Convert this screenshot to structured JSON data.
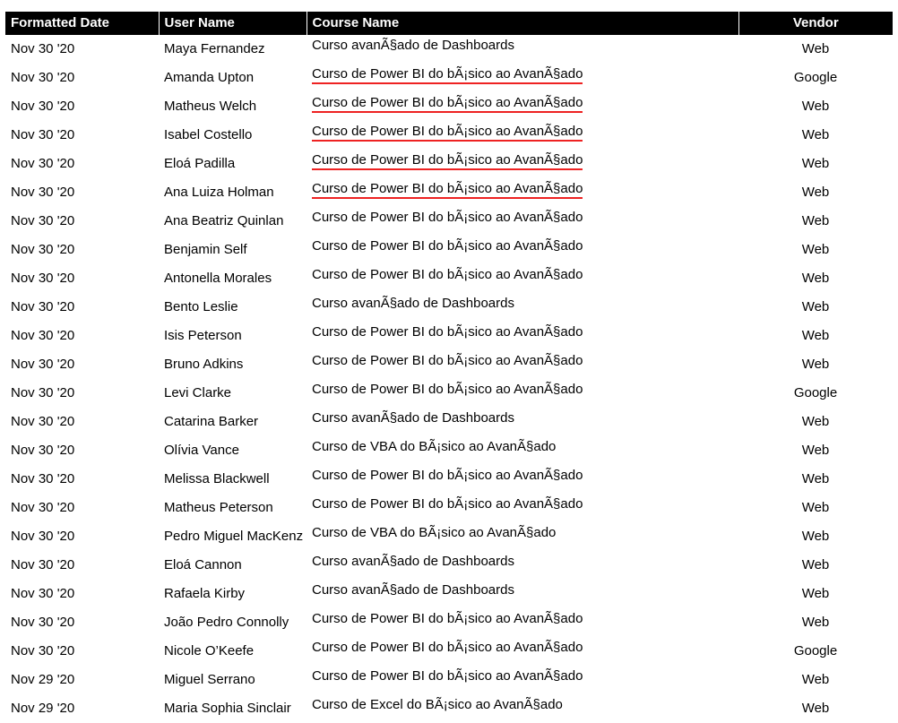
{
  "sheet": {
    "columns": [
      {
        "key": "date",
        "label": "Formatted Date",
        "align": "left"
      },
      {
        "key": "user",
        "label": "User Name",
        "align": "left"
      },
      {
        "key": "course",
        "label": "Course Name",
        "align": "left"
      },
      {
        "key": "vendor",
        "label": "Vendor",
        "align": "center"
      }
    ],
    "header_background": "#000000",
    "header_color": "#ffffff",
    "underline_color": "#ee2222",
    "rows": [
      {
        "date": "Nov 30 '20",
        "user": "Maya Fernandez",
        "course": "Curso avanÃ§ado de Dashboards",
        "vendor": "Web",
        "underlined": false
      },
      {
        "date": "Nov 30 '20",
        "user": "Amanda Upton",
        "course": "Curso de Power BI do bÃ¡sico ao AvanÃ§ado",
        "vendor": "Google",
        "underlined": true
      },
      {
        "date": "Nov 30 '20",
        "user": "Matheus Welch",
        "course": "Curso de Power BI do bÃ¡sico ao AvanÃ§ado",
        "vendor": "Web",
        "underlined": true
      },
      {
        "date": "Nov 30 '20",
        "user": "Isabel Costello",
        "course": "Curso de Power BI do bÃ¡sico ao AvanÃ§ado",
        "vendor": "Web",
        "underlined": true
      },
      {
        "date": "Nov 30 '20",
        "user": "Eloá Padilla",
        "course": "Curso de Power BI do bÃ¡sico ao AvanÃ§ado",
        "vendor": "Web",
        "underlined": true
      },
      {
        "date": "Nov 30 '20",
        "user": "Ana Luiza Holman",
        "course": "Curso de Power BI do bÃ¡sico ao AvanÃ§ado",
        "vendor": "Web",
        "underlined": true
      },
      {
        "date": "Nov 30 '20",
        "user": "Ana Beatriz Quinlan",
        "course": "Curso de Power BI do bÃ¡sico ao AvanÃ§ado",
        "vendor": "Web",
        "underlined": false
      },
      {
        "date": "Nov 30 '20",
        "user": "Benjamin Self",
        "course": "Curso de Power BI do bÃ¡sico ao AvanÃ§ado",
        "vendor": "Web",
        "underlined": false
      },
      {
        "date": "Nov 30 '20",
        "user": "Antonella Morales",
        "course": "Curso de Power BI do bÃ¡sico ao AvanÃ§ado",
        "vendor": "Web",
        "underlined": false
      },
      {
        "date": "Nov 30 '20",
        "user": "Bento Leslie",
        "course": "Curso avanÃ§ado de Dashboards",
        "vendor": "Web",
        "underlined": false
      },
      {
        "date": "Nov 30 '20",
        "user": "Isis Peterson",
        "course": "Curso de Power BI do bÃ¡sico ao AvanÃ§ado",
        "vendor": "Web",
        "underlined": false
      },
      {
        "date": "Nov 30 '20",
        "user": "Bruno Adkins",
        "course": "Curso de Power BI do bÃ¡sico ao AvanÃ§ado",
        "vendor": "Web",
        "underlined": false
      },
      {
        "date": "Nov 30 '20",
        "user": "Levi Clarke",
        "course": "Curso de Power BI do bÃ¡sico ao AvanÃ§ado",
        "vendor": "Google",
        "underlined": false
      },
      {
        "date": "Nov 30 '20",
        "user": "Catarina Barker",
        "course": "Curso avanÃ§ado de Dashboards",
        "vendor": "Web",
        "underlined": false
      },
      {
        "date": "Nov 30 '20",
        "user": "Olívia Vance",
        "course": "Curso de VBA do BÃ¡sico ao AvanÃ§ado",
        "vendor": "Web",
        "underlined": false
      },
      {
        "date": "Nov 30 '20",
        "user": "Melissa Blackwell",
        "course": "Curso de Power BI do bÃ¡sico ao AvanÃ§ado",
        "vendor": "Web",
        "underlined": false
      },
      {
        "date": "Nov 30 '20",
        "user": "Matheus Peterson",
        "course": "Curso de Power BI do bÃ¡sico ao AvanÃ§ado",
        "vendor": "Web",
        "underlined": false
      },
      {
        "date": "Nov 30 '20",
        "user": "Pedro Miguel MacKenz",
        "course": "Curso de VBA do BÃ¡sico ao AvanÃ§ado",
        "vendor": "Web",
        "underlined": false
      },
      {
        "date": "Nov 30 '20",
        "user": "Eloá Cannon",
        "course": "Curso avanÃ§ado de Dashboards",
        "vendor": "Web",
        "underlined": false
      },
      {
        "date": "Nov 30 '20",
        "user": "Rafaela Kirby",
        "course": "Curso avanÃ§ado de Dashboards",
        "vendor": "Web",
        "underlined": false
      },
      {
        "date": "Nov 30 '20",
        "user": "João Pedro Connolly",
        "course": "Curso de Power BI do bÃ¡sico ao AvanÃ§ado",
        "vendor": "Web",
        "underlined": false
      },
      {
        "date": "Nov 30 '20",
        "user": "Nicole O’Keefe",
        "course": "Curso de Power BI do bÃ¡sico ao AvanÃ§ado",
        "vendor": "Google",
        "underlined": false
      },
      {
        "date": "Nov 29 '20",
        "user": "Miguel Serrano",
        "course": "Curso de Power BI do bÃ¡sico ao AvanÃ§ado",
        "vendor": "Web",
        "underlined": false
      },
      {
        "date": "Nov 29 '20",
        "user": "Maria Sophia Sinclair",
        "course": "Curso de Excel do BÃ¡sico ao AvanÃ§ado",
        "vendor": "Web",
        "underlined": false
      }
    ]
  }
}
